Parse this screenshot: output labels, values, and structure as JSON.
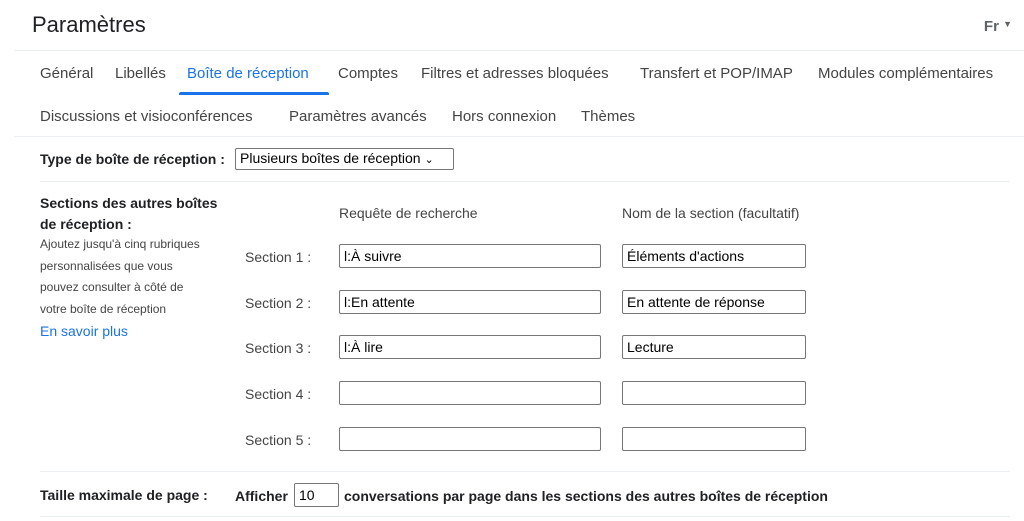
{
  "header": {
    "title": "Paramètres",
    "language": "Fr",
    "language_icon": "caret-down-icon"
  },
  "tabs": [
    {
      "label": "Général"
    },
    {
      "label": "Libellés"
    },
    {
      "label": "Boîte de réception",
      "active": true
    },
    {
      "label": "Comptes"
    },
    {
      "label": "Filtres et adresses bloquées"
    },
    {
      "label": "Transfert et POP/IMAP"
    },
    {
      "label": "Modules complémentaires"
    },
    {
      "label": "Discussions et visioconférences"
    },
    {
      "label": "Paramètres avancés"
    },
    {
      "label": "Hors connexion"
    },
    {
      "label": "Thèmes"
    }
  ],
  "inbox_type": {
    "label": "Type de boîte de réception :",
    "value": "Plusieurs boîtes de réception"
  },
  "sections": {
    "title_line1": "Sections des autres boîtes",
    "title_line2": "de réception :",
    "help": [
      "Ajoutez jusqu'à cinq rubriques",
      "personnalisées que vous",
      "pouvez consulter à côté de",
      "votre boîte de réception"
    ],
    "learn_more": "En savoir plus",
    "col_query": "Requête de recherche",
    "col_name": "Nom de la section (facultatif)",
    "rows": [
      {
        "label": "Section 1 :",
        "query": "l:À suivre",
        "name": "Éléments d'actions"
      },
      {
        "label": "Section 2 :",
        "query": "l:En attente",
        "name": "En attente de réponse"
      },
      {
        "label": "Section 3 :",
        "query": "l:À lire",
        "name": "Lecture"
      },
      {
        "label": "Section 4 :",
        "query": "",
        "name": ""
      },
      {
        "label": "Section 5 :",
        "query": "",
        "name": ""
      }
    ]
  },
  "page_size": {
    "label": "Taille maximale de page :",
    "prefix": "Afficher",
    "value": "10",
    "suffix": "conversations par page dans les sections des autres boîtes de réception"
  },
  "accent": "#1a73e8"
}
